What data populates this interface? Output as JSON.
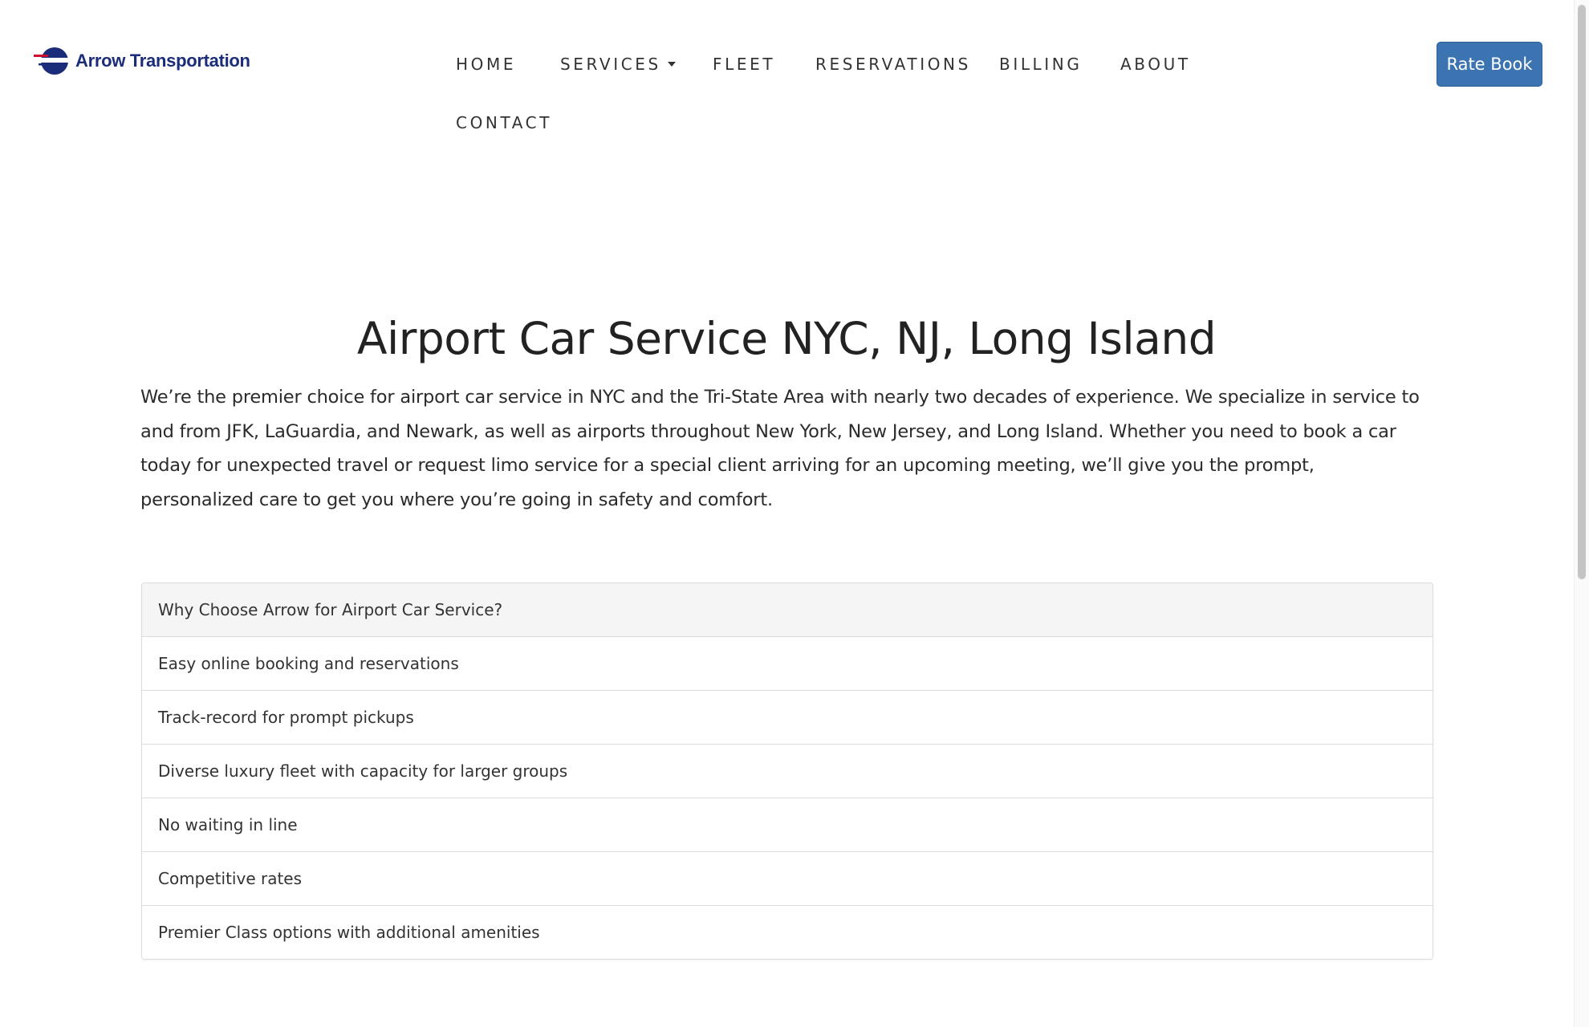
{
  "brand": {
    "name": "Arrow Transportation",
    "colors": {
      "navy": "#1b2d7a",
      "red": "#c8102e",
      "button": "#3b74b0"
    }
  },
  "nav": {
    "items": [
      {
        "label": "HOME"
      },
      {
        "label": "SERVICES",
        "has_dropdown": true
      },
      {
        "label": "FLEET"
      },
      {
        "label": "RESERVATIONS"
      },
      {
        "label": "BILLING"
      },
      {
        "label": "ABOUT"
      },
      {
        "label": "CONTACT"
      }
    ],
    "cta_label": "Rate Book"
  },
  "main": {
    "title": "Airport Car Service NYC, NJ, Long Island",
    "intro": "We’re the premier choice for airport car service in NYC and the Tri-State Area with nearly two decades of experience. We specialize in service to and from JFK, LaGuardia, and Newark, as well as airports throughout New York, New Jersey, and Long Island. Whether you need to book a car today for unexpected travel or request limo service for a special client arriving for an upcoming meeting, we’ll give you the prompt, personalized care to get you where you’re going in safety and comfort.",
    "panel": {
      "heading": "Why Choose Arrow for Airport Car Service?",
      "items": [
        "Easy online booking and reservations",
        "Track-record for prompt pickups",
        "Diverse luxury fleet with capacity for larger groups",
        "No waiting in line",
        "Competitive rates",
        "Premier Class options with additional amenities"
      ]
    }
  }
}
